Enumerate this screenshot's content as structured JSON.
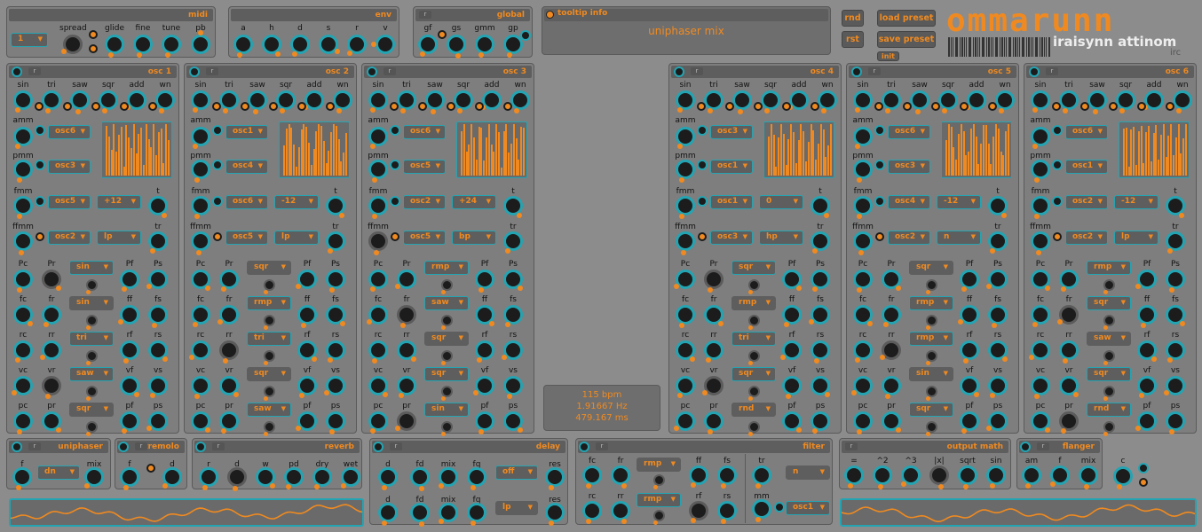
{
  "app": {
    "logo": "ommarunn",
    "subtitle": "iraisynn attinom",
    "badge": "irc"
  },
  "midi": {
    "title": "midi",
    "labels": [
      "spread",
      "glide",
      "fine",
      "tune",
      "pb"
    ],
    "channel": "1"
  },
  "env": {
    "title": "env",
    "labels": [
      "a",
      "h",
      "d",
      "s",
      "r",
      "v"
    ]
  },
  "global": {
    "title": "global",
    "r": "r",
    "labels": [
      "gf",
      "gs",
      "gmm",
      "gp"
    ]
  },
  "tooltip": {
    "title": "tooltip info",
    "text": "uniphaser mix"
  },
  "buttons": {
    "rnd": "rnd",
    "rst": "rst",
    "load": "load preset",
    "save": "save preset",
    "init": "init"
  },
  "common": {
    "r": "r",
    "wave_labels": [
      "sin",
      "tri",
      "saw",
      "sqr",
      "add",
      "wn"
    ],
    "amm": "amm",
    "pmm": "pmm",
    "fmm": "fmm",
    "ffmm": "ffmm",
    "t": "t",
    "tr": "tr",
    "mod_rows": [
      [
        "Pc",
        "Pr",
        "Pf",
        "Ps"
      ],
      [
        "fc",
        "fr",
        "ff",
        "fs"
      ],
      [
        "rc",
        "rr",
        "rf",
        "rs"
      ],
      [
        "vc",
        "vr",
        "vf",
        "vs"
      ],
      [
        "pc",
        "pr",
        "pf",
        "ps"
      ]
    ]
  },
  "oscs": [
    {
      "title": "osc 1",
      "amm_src": "osc6",
      "pmm_src": "osc3",
      "fmm_src": "osc5",
      "fmm_val": "+12",
      "ffmm_src": "osc2",
      "ffmm_filt": "lp",
      "mod_waves": [
        "sin",
        "sin",
        "tri",
        "saw",
        "sqr"
      ]
    },
    {
      "title": "osc 2",
      "amm_src": "osc1",
      "pmm_src": "osc4",
      "fmm_src": "osc6",
      "fmm_val": "-12",
      "ffmm_src": "osc5",
      "ffmm_filt": "lp",
      "mod_waves": [
        "sqr",
        "rmp",
        "tri",
        "sqr",
        "saw"
      ]
    },
    {
      "title": "osc 3",
      "amm_src": "osc6",
      "pmm_src": "osc5",
      "fmm_src": "osc2",
      "fmm_val": "+24",
      "ffmm_src": "osc5",
      "ffmm_filt": "bp",
      "mod_waves": [
        "rmp",
        "saw",
        "sqr",
        "sqr",
        "sin"
      ]
    },
    {
      "title": "osc 4",
      "amm_src": "osc3",
      "pmm_src": "osc1",
      "fmm_src": "osc1",
      "fmm_val": "0",
      "ffmm_src": "osc3",
      "ffmm_filt": "hp",
      "mod_waves": [
        "sqr",
        "rmp",
        "tri",
        "sqr",
        "rnd"
      ]
    },
    {
      "title": "osc 5",
      "amm_src": "osc6",
      "pmm_src": "osc3",
      "fmm_src": "osc4",
      "fmm_val": "-12",
      "ffmm_src": "osc2",
      "ffmm_filt": "n",
      "mod_waves": [
        "sqr",
        "rmp",
        "rmp",
        "sin",
        "sqr"
      ]
    },
    {
      "title": "osc 6",
      "amm_src": "osc6",
      "pmm_src": "osc1",
      "fmm_src": "osc2",
      "fmm_val": "-12",
      "ffmm_src": "osc2",
      "ffmm_filt": "lp",
      "mod_waves": [
        "rmp",
        "sqr",
        "saw",
        "sqr",
        "rnd"
      ]
    }
  ],
  "tempo": {
    "bpm": "115 bpm",
    "hz": "1.91667 Hz",
    "ms": "479.167 ms"
  },
  "uniphaser": {
    "title": "uniphaser",
    "labels": [
      "f",
      "mix"
    ],
    "mode": "dn"
  },
  "tremolo": {
    "title": "tremolo",
    "labels": [
      "f",
      "d"
    ]
  },
  "reverb": {
    "title": "reverb",
    "labels": [
      "r",
      "d",
      "w",
      "pd",
      "dry",
      "wet"
    ]
  },
  "delay": {
    "title": "delay",
    "labels": [
      "d",
      "fd",
      "mix",
      "fq",
      "res"
    ],
    "mode1": "off",
    "mode2": "lp"
  },
  "filter": {
    "title": "filter",
    "row1": [
      "fc",
      "fr",
      "ff",
      "fs"
    ],
    "row2": [
      "rc",
      "rr",
      "rf",
      "rs"
    ],
    "wave1": "rmp",
    "wave2": "rmp",
    "tr": "tr",
    "mm": "mm",
    "type": "n",
    "src": "osc1"
  },
  "output_math": {
    "title": "output math",
    "labels": [
      "=",
      "^2",
      "^3",
      "|x|",
      "sqrt",
      "sin"
    ]
  },
  "flanger": {
    "title": "flanger",
    "labels": [
      "am",
      "f",
      "mix",
      "c"
    ]
  }
}
